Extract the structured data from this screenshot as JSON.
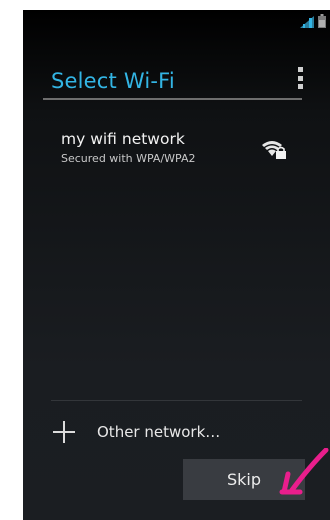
{
  "screen": {
    "title": "Select Wi-Fi"
  },
  "network": {
    "name": "my wifi network",
    "security": "Secured with WPA/WPA2"
  },
  "other_network": {
    "label": "Other network…"
  },
  "footer": {
    "skip_label": "Skip"
  },
  "icons": {
    "signal": "signal-icon",
    "battery": "battery-icon",
    "overflow": "overflow-menu-icon",
    "wifi_locked": "wifi-lock-icon",
    "add": "plus-icon",
    "annotation": "arrow-annotation-icon"
  },
  "colors": {
    "accent": "#33b5e5",
    "annotation": "#e91e8c",
    "background": "#1a1d21"
  }
}
